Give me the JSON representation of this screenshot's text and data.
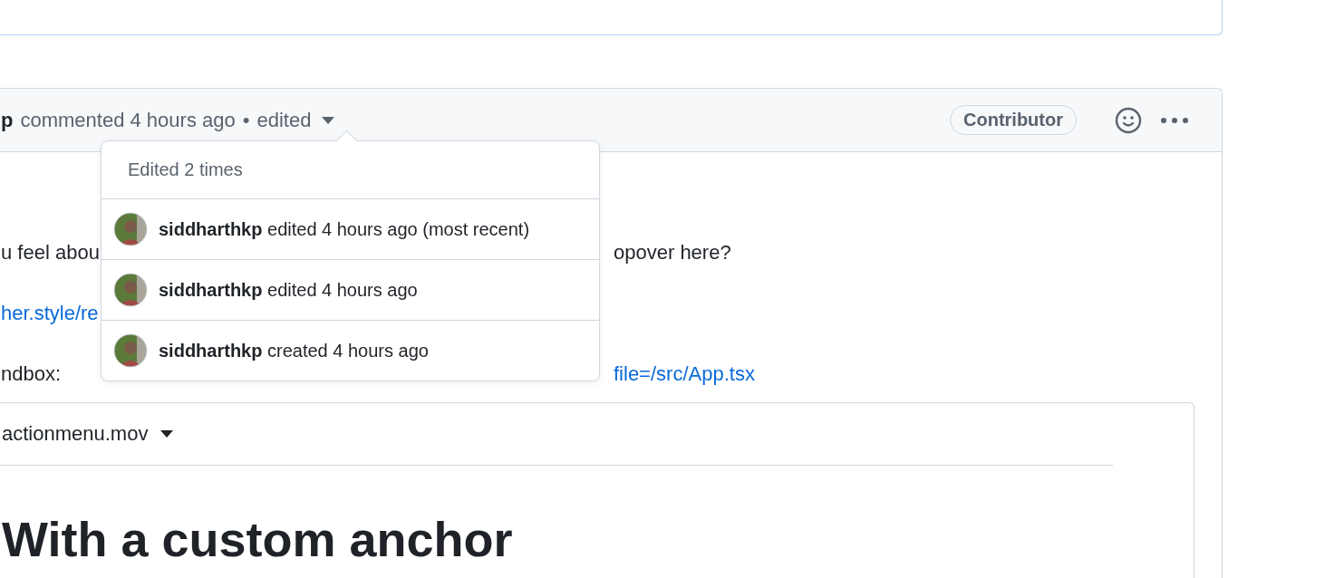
{
  "comment": {
    "author": "p",
    "action": "commented 4 hours ago",
    "separator": "•",
    "edited_label": "edited",
    "badge": "Contributor",
    "body_lines": [
      {
        "left": {
          "kind": "text",
          "text": "u feel abou"
        },
        "right": {
          "kind": "text",
          "text": "opover here?"
        }
      },
      {
        "left": {
          "kind": "link",
          "text": "her.style/re"
        }
      },
      {
        "left": {
          "kind": "text",
          "text": "ndbox:"
        },
        "right": {
          "kind": "link",
          "text": "file=/src/App.tsx"
        }
      }
    ],
    "attachment": {
      "filename": "actionmenu.mov",
      "heading": "With a custom anchor"
    }
  },
  "edit_history": {
    "title": "Edited 2 times",
    "entries": [
      {
        "user": "siddharthkp",
        "action": "edited 4 hours ago (most recent)"
      },
      {
        "user": "siddharthkp",
        "action": "edited 4 hours ago"
      },
      {
        "user": "siddharthkp",
        "action": "created 4 hours ago"
      }
    ]
  }
}
